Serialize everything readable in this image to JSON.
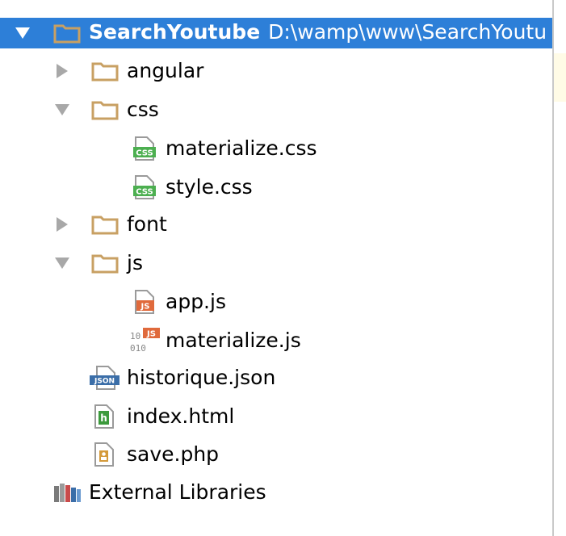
{
  "tree": {
    "root": {
      "name": "SearchYoutube",
      "path": "D:\\wamp\\www\\SearchYoutu"
    },
    "items": [
      {
        "label": "angular"
      },
      {
        "label": "css"
      },
      {
        "label": "materialize.css",
        "badge": "CSS"
      },
      {
        "label": "style.css",
        "badge": "CSS"
      },
      {
        "label": "font"
      },
      {
        "label": "js"
      },
      {
        "label": "app.js",
        "badge": "JS"
      },
      {
        "label": "materialize.js",
        "badge": "JS",
        "minified_marks": [
          "10",
          "010"
        ]
      },
      {
        "label": "historique.json",
        "badge": "JSON"
      },
      {
        "label": "index.html",
        "badge": "h"
      },
      {
        "label": "save.php"
      },
      {
        "label": "External Libraries"
      }
    ]
  },
  "colors": {
    "selection": "#2d7fd8",
    "folder": "#c8a063",
    "css_badge": "#4caf50",
    "js_badge": "#e06a3c",
    "html_badge": "#3c9a3c",
    "json_badge": "#3b6ea8",
    "php_badge": "#d49a3a"
  }
}
